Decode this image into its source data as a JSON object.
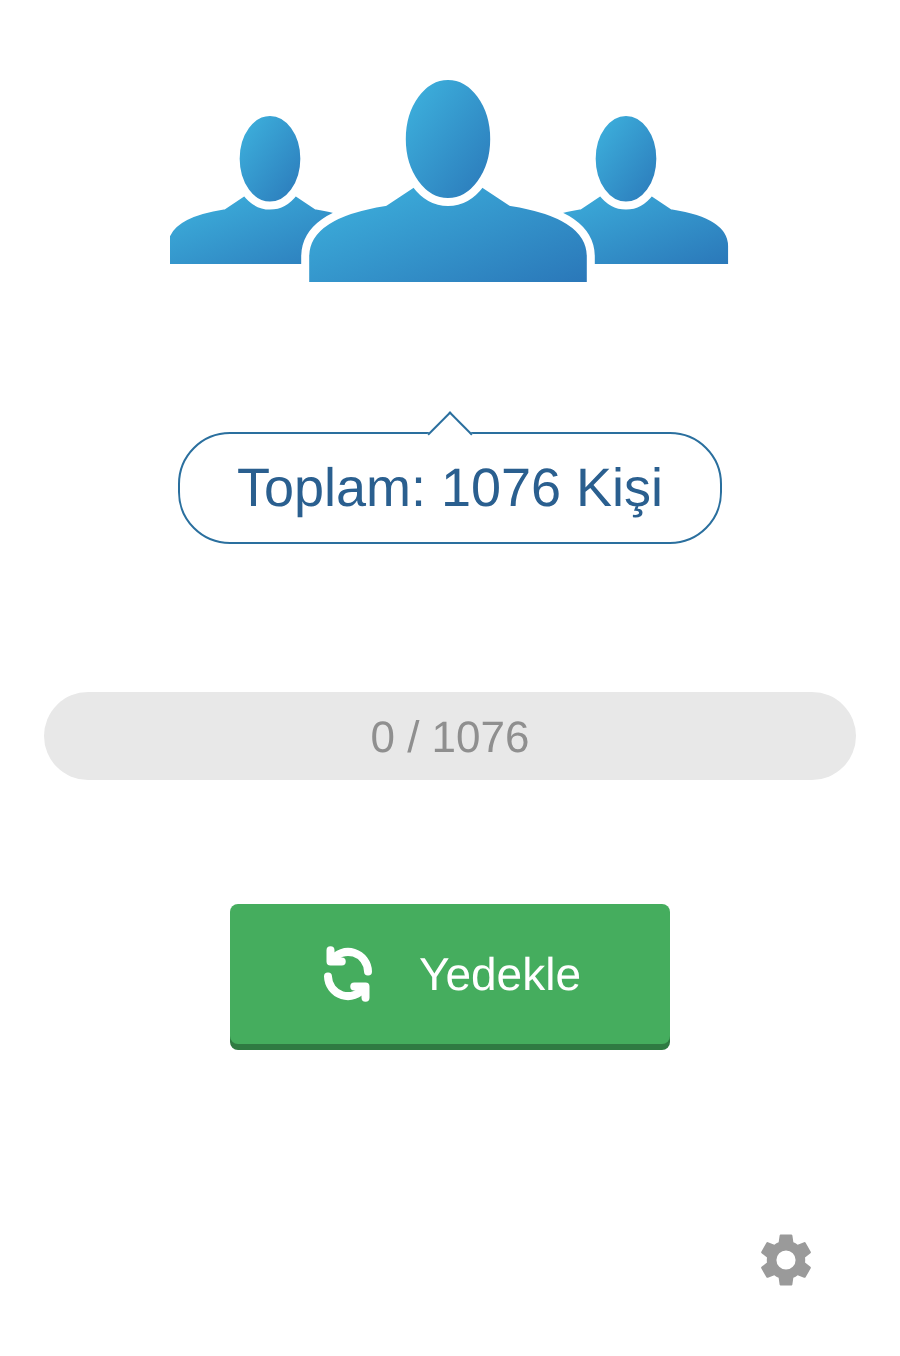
{
  "total_bubble": {
    "text": "Toplam: 1076 Kişi"
  },
  "progress": {
    "level": 0,
    "reading": "0 / 1076"
  },
  "backup_button": {
    "label": "Yedekle"
  }
}
